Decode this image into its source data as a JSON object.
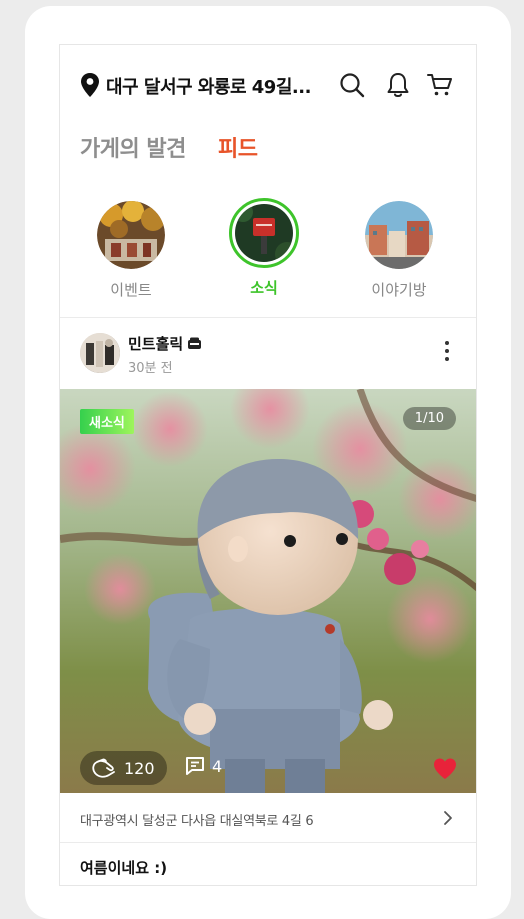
{
  "header": {
    "location": "대구 달서구 와룡로 49길...",
    "icons": [
      "location-pin-icon",
      "search-icon",
      "bell-icon",
      "cart-icon"
    ]
  },
  "tabs": [
    {
      "label": "가게의 발견",
      "active": false
    },
    {
      "label": "피드",
      "active": true
    }
  ],
  "stories": [
    {
      "label": "이벤트",
      "active": false
    },
    {
      "label": "소식",
      "active": true
    },
    {
      "label": "이야기방",
      "active": false
    }
  ],
  "post": {
    "author": "민트홀릭",
    "time": "30분 전",
    "tag": "새소식",
    "image_counter": "1/10",
    "claps": "120",
    "comments": "4",
    "address": "대구광역시 달성군 다사읍 대실역북로 4길 6",
    "caption": "여름이네요 :)"
  },
  "colors": {
    "accent_feed": "#e8542a",
    "accent_green": "#3ec42b",
    "heart": "#e8233a"
  }
}
